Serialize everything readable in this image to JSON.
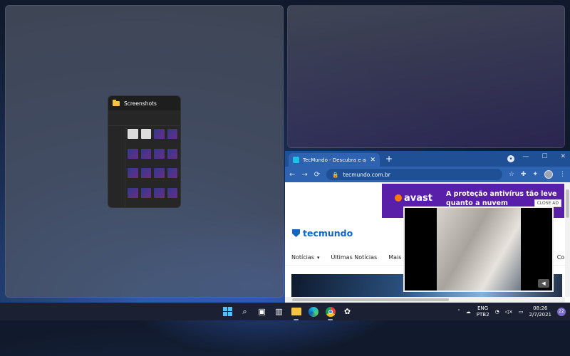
{
  "explorer_window": {
    "title": "Screenshots",
    "icon": "folder-icon"
  },
  "chrome": {
    "tab_title": "TecMundo - Descubra e aprenda",
    "tab_close": "✕",
    "new_tab": "+",
    "url": "tecmundo.com.br",
    "window_buttons": {
      "minimize": "—",
      "maximize": "☐",
      "close": "✕"
    },
    "nav_back": "←",
    "nav_forward": "→",
    "reload": "⟳"
  },
  "page": {
    "ad": {
      "brand": "avast",
      "text": "A proteção antivírus tão leve quanto a nuvem",
      "close_label": "CLOSE AD"
    },
    "logo": "tecmundo",
    "nav_items": [
      "Notícias",
      "Últimas Notícias",
      "Mais Li",
      "Com"
    ]
  },
  "taskbar": {
    "lang": "ENG",
    "layout": "PTB2",
    "time": "08:26",
    "date": "2/7/2021",
    "notifications": "22"
  },
  "colors": {
    "chrome_frame": "#1f5096",
    "ad_bg": "#5a1fa8",
    "brand": "#0f67c3"
  }
}
